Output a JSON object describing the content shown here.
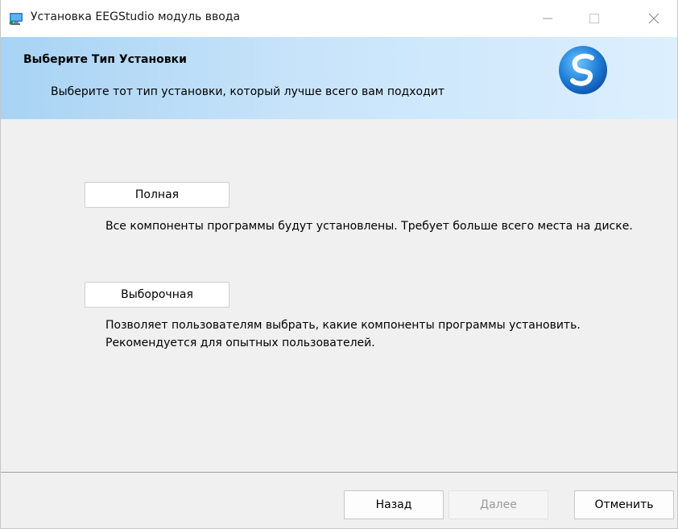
{
  "window": {
    "title": "Установка EEGStudio модуль ввода"
  },
  "header": {
    "title": "Выберите Тип Установки",
    "subtitle": "Выберите тот тип установки, который лучше всего вам подходит",
    "logo_icon": "eegstudio-logo-icon"
  },
  "options": [
    {
      "label": "Полная",
      "description": "Все компоненты программы будут установлены. Требует больше всего места на диске."
    },
    {
      "label": "Выборочная",
      "description": "Позволяет пользователям выбрать, какие компоненты программы установить. Рекомендуется для опытных пользователей."
    }
  ],
  "footer": {
    "back_label": "Назад",
    "next_label": "Далее",
    "cancel_label": "Отменить"
  },
  "colors": {
    "header_gradient_start": "#a8d3f4",
    "header_gradient_end": "#dcefff",
    "logo_blue": "#1e7fd6",
    "disabled_text": "#9a9a9a"
  }
}
